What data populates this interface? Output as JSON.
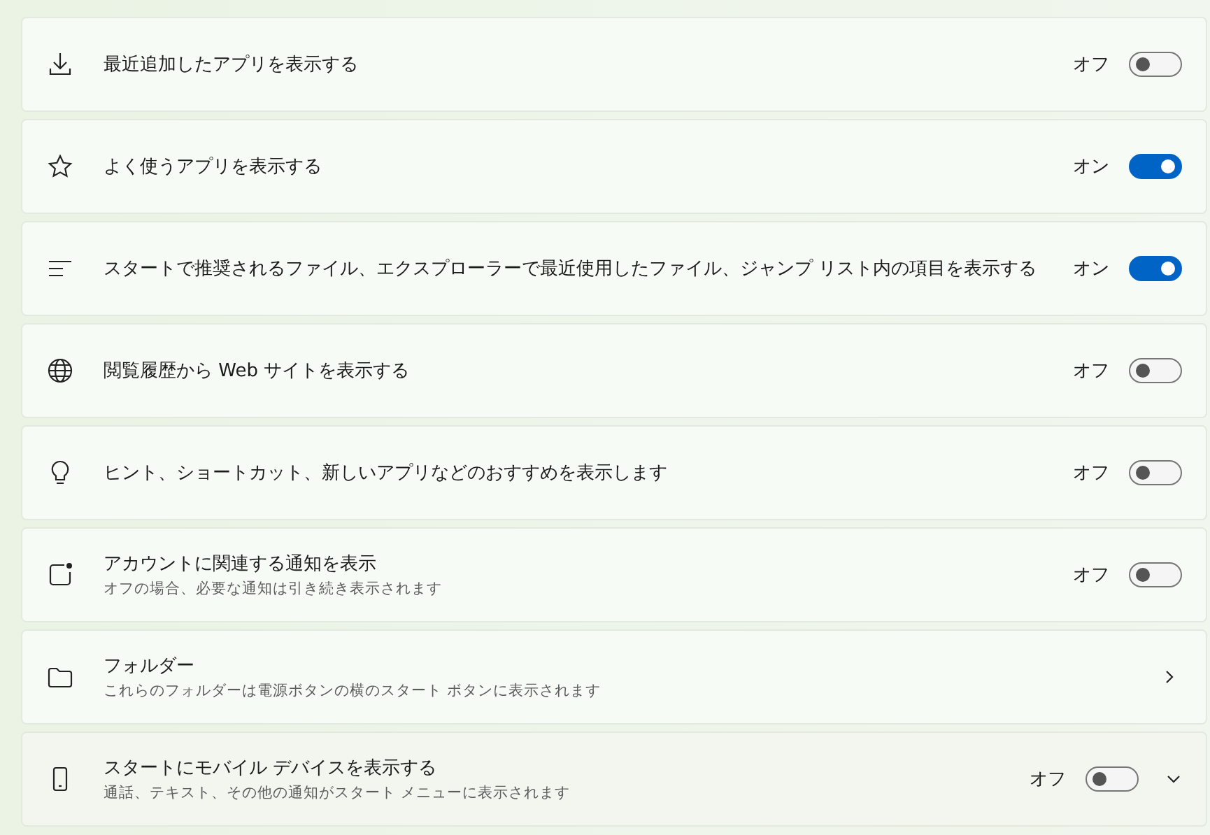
{
  "settings": [
    {
      "kind": "toggle",
      "title": "最近追加したアプリを表示する",
      "state_label": "オフ",
      "on": false
    },
    {
      "kind": "toggle",
      "title": "よく使うアプリを表示する",
      "state_label": "オン",
      "on": true
    },
    {
      "kind": "toggle",
      "title": "スタートで推奨されるファイル、エクスプローラーで最近使用したファイル、ジャンプ リスト内の項目を表示する",
      "state_label": "オン",
      "on": true
    },
    {
      "kind": "toggle",
      "title": "閲覧履歴から Web サイトを表示する",
      "state_label": "オフ",
      "on": false
    },
    {
      "kind": "toggle",
      "title": "ヒント、ショートカット、新しいアプリなどのおすすめを表示します",
      "state_label": "オフ",
      "on": false
    },
    {
      "kind": "toggle",
      "title": "アカウントに関連する通知を表示",
      "subtitle": "オフの場合、必要な通知は引き続き表示されます",
      "state_label": "オフ",
      "on": false
    },
    {
      "kind": "link",
      "title": "フォルダー",
      "subtitle": "これらのフォルダーは電源ボタンの横のスタート ボタンに表示されます"
    },
    {
      "kind": "expander",
      "title": "スタートにモバイル デバイスを表示する",
      "subtitle": "通話、テキスト、その他の通知がスタート メニューに表示されます",
      "state_label": "オフ",
      "on": false
    }
  ]
}
